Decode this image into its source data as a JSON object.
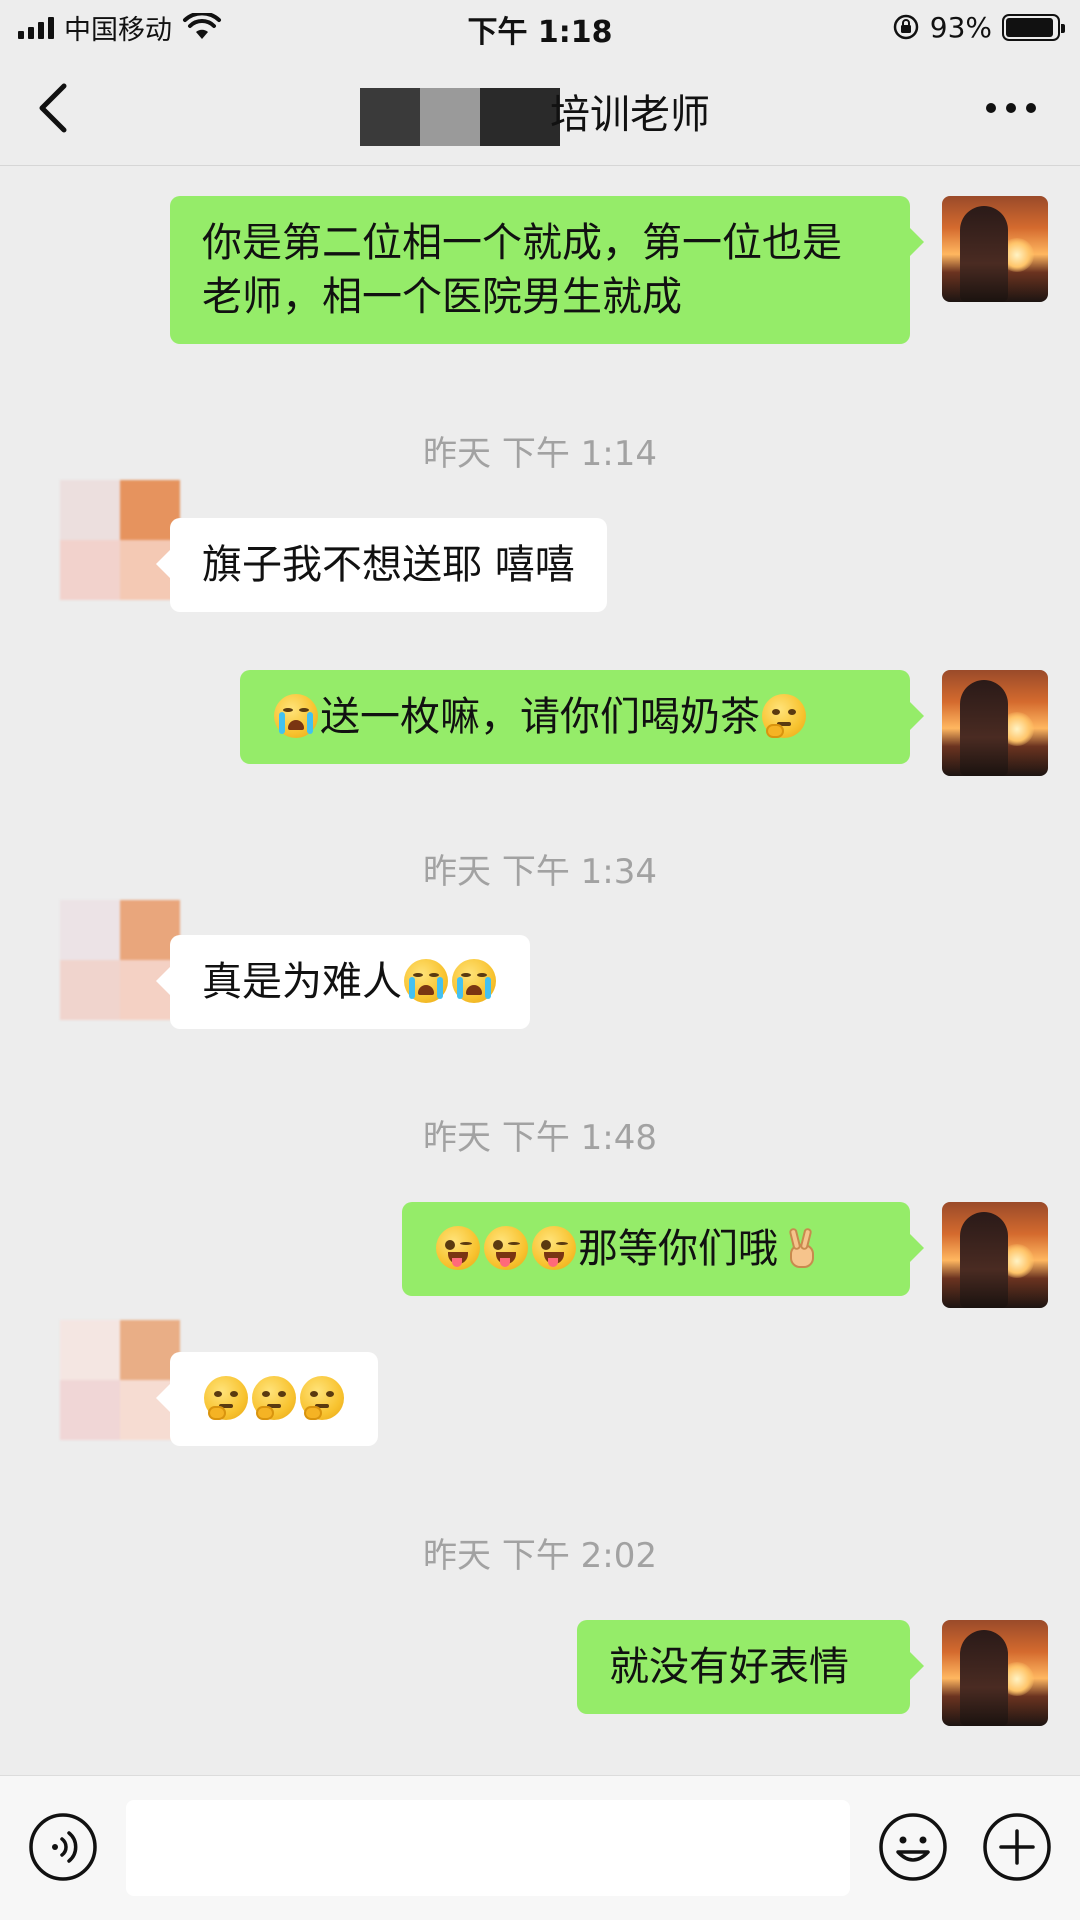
{
  "status_bar": {
    "carrier": "中国移动",
    "time": "下午 1:18",
    "battery_percent": "93%",
    "battery_level": 0.93
  },
  "nav": {
    "title_visible": "培训老师",
    "back_icon": "chevron-left-icon",
    "more_icon": "more-dots-icon"
  },
  "messages": [
    {
      "sender": "me",
      "text": "你是第二位相一个就成，第一位也是老师，相一个医院男生就成"
    },
    {
      "type": "timestamp",
      "text": "昨天 下午 1:14"
    },
    {
      "sender": "them",
      "text": "旗子我不想送耶 嘻嘻"
    },
    {
      "sender": "me",
      "prefix_emoji": "cry-emoji",
      "text": "送一枚嘛，请你们喝奶茶",
      "suffix_emoji": "thinking-emoji"
    },
    {
      "type": "timestamp",
      "text": "昨天 下午 1:34"
    },
    {
      "sender": "them",
      "text": "真是为难人",
      "suffix_emojis": [
        "cry-emoji",
        "cry-emoji"
      ]
    },
    {
      "type": "timestamp",
      "text": "昨天 下午 1:48"
    },
    {
      "sender": "me",
      "prefix_emojis": [
        "wink-tongue-emoji",
        "wink-tongue-emoji",
        "wink-tongue-emoji"
      ],
      "text": "那等你们哦",
      "suffix_emoji": "victory-hand-emoji"
    },
    {
      "sender": "them",
      "emojis": [
        "thinking-emoji",
        "thinking-emoji",
        "thinking-emoji"
      ]
    },
    {
      "type": "timestamp",
      "text": "昨天 下午 2:02"
    },
    {
      "sender": "me",
      "text": "就没有好表情"
    }
  ],
  "input_bar": {
    "voice_icon": "voice-icon",
    "text_value": "",
    "emoji_icon": "emoji-icon",
    "plus_icon": "plus-icon"
  },
  "colors": {
    "background": "#ededed",
    "my_bubble": "#95ec69",
    "their_bubble": "#ffffff",
    "timestamp_text": "#a2a2a2"
  }
}
